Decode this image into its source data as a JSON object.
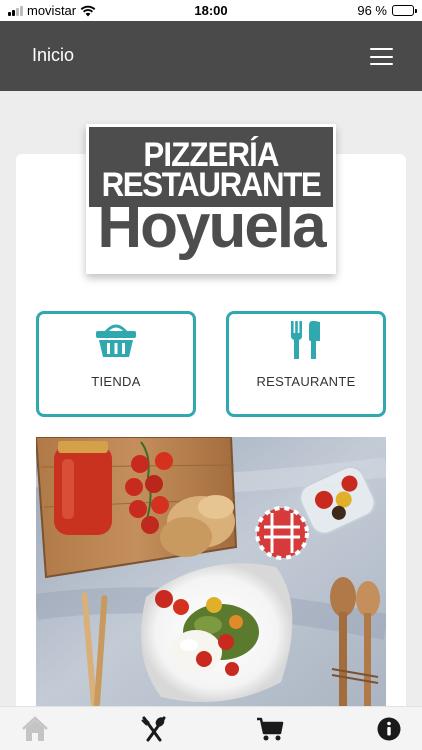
{
  "status_bar": {
    "carrier": "movistar",
    "time": "18:00",
    "battery": "96 %",
    "battery_level": 0.96
  },
  "header": {
    "title": "Inicio"
  },
  "logo": {
    "line1": "PIZZERÍA",
    "line2": "RESTAURANTE",
    "line3": "Hoyuela"
  },
  "buttons": [
    {
      "label": "TIENDA",
      "icon": "basket-icon"
    },
    {
      "label": "RESTAURANTE",
      "icon": "fork-knife-icon"
    }
  ],
  "tabbar": [
    {
      "icon": "home-icon"
    },
    {
      "icon": "fork-spoon-icon"
    },
    {
      "icon": "cart-icon"
    },
    {
      "icon": "info-icon"
    }
  ],
  "colors": {
    "accent": "#2fa8b0",
    "header": "#4a4a4a",
    "background": "#ededed"
  }
}
